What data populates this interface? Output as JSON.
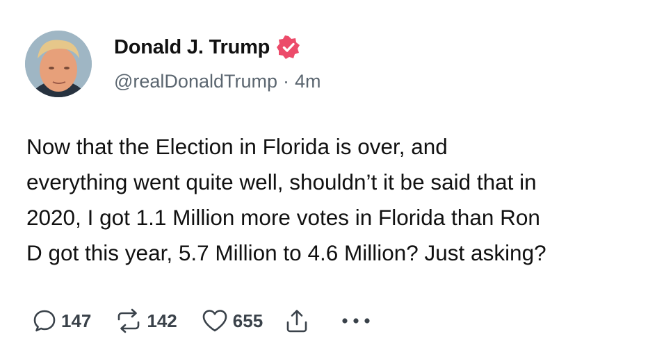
{
  "author": {
    "display_name": "Donald J. Trump",
    "handle": "@realDonaldTrump",
    "separator": "·",
    "timestamp": "4m",
    "verified": true
  },
  "post": {
    "lines": [
      "Now that the Election in Florida is over, and",
      "everything went quite well, shouldn’t it be said that in",
      "2020, I got 1.1 Million more votes in Florida than Ron",
      "D got this year, 5.7 Million to 4.6 Million? Just asking?"
    ]
  },
  "actions": {
    "reply_count": "147",
    "repost_count": "142",
    "like_count": "655"
  },
  "icons": {
    "reply": "reply-icon",
    "repost": "repost-icon",
    "like": "heart-icon",
    "share": "share-icon",
    "more": "more-icon",
    "verified": "verified-badge-icon"
  },
  "colors": {
    "verified_badge": "#ec4b6a",
    "text": "#111111",
    "secondary_text": "#5b6670"
  }
}
